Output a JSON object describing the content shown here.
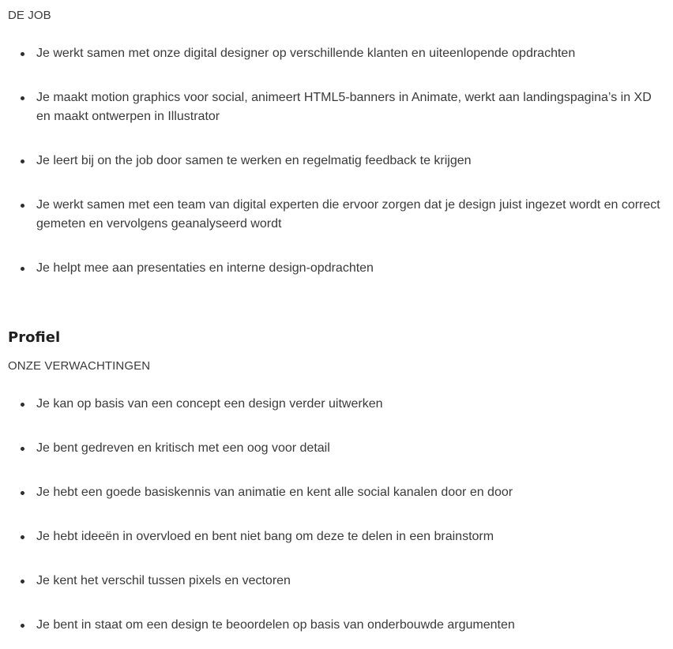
{
  "job": {
    "heading": "DE JOB",
    "items": [
      "Je werkt samen met onze digital designer op verschillende klanten en uiteenlopende opdrachten",
      "Je maakt motion graphics voor social, animeert HTML5-banners in Animate, werkt aan landingspagina’s in XD en maakt ontwerpen in Illustrator",
      "Je leert bij on the job door samen te werken en regelmatig feedback te krijgen",
      "Je werkt samen met een team van digital experten die ervoor zorgen dat je design juist ingezet wordt en correct gemeten en vervolgens geanalyseerd wordt",
      "Je helpt mee aan presentaties en interne design-opdrachten"
    ]
  },
  "profile": {
    "title": "Profiel",
    "heading": "ONZE VERWACHTINGEN",
    "items": [
      "Je kan op basis van een concept een design verder uitwerken",
      "Je bent gedreven en kritisch met een oog voor detail",
      "Je hebt een goede basiskennis van animatie en kent alle social kanalen door en door",
      "Je hebt ideeën in overvloed en bent niet bang om deze te delen in een brainstorm",
      "Je kent het verschil tussen pixels en vectoren",
      "Je bent in staat om een design te beoordelen op basis van onderbouwde argumenten"
    ]
  }
}
